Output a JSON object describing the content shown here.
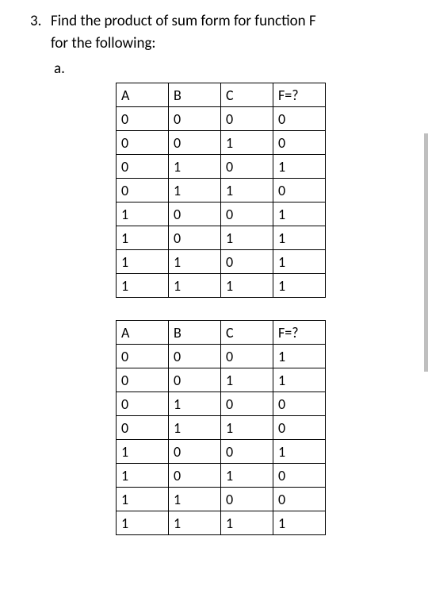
{
  "question": {
    "number": "3.",
    "line1": "Find the product of sum form for function F",
    "line2": "for the following:",
    "sub_label": "a."
  },
  "table_headers": {
    "A": "A",
    "B": "B",
    "C": "C",
    "F": "F=?"
  },
  "tables": [
    {
      "rows": [
        {
          "A": "0",
          "B": "0",
          "C": "0",
          "F": "0"
        },
        {
          "A": "0",
          "B": "0",
          "C": "1",
          "F": "0"
        },
        {
          "A": "0",
          "B": "1",
          "C": "0",
          "F": "1"
        },
        {
          "A": "0",
          "B": "1",
          "C": "1",
          "F": "0"
        },
        {
          "A": "1",
          "B": "0",
          "C": "0",
          "F": "1"
        },
        {
          "A": "1",
          "B": "0",
          "C": "1",
          "F": "1"
        },
        {
          "A": "1",
          "B": "1",
          "C": "0",
          "F": "1"
        },
        {
          "A": "1",
          "B": "1",
          "C": "1",
          "F": "1"
        }
      ]
    },
    {
      "rows": [
        {
          "A": "0",
          "B": "0",
          "C": "0",
          "F": "1"
        },
        {
          "A": "0",
          "B": "0",
          "C": "1",
          "F": "1"
        },
        {
          "A": "0",
          "B": "1",
          "C": "0",
          "F": "0"
        },
        {
          "A": "0",
          "B": "1",
          "C": "1",
          "F": "0"
        },
        {
          "A": "1",
          "B": "0",
          "C": "0",
          "F": "1"
        },
        {
          "A": "1",
          "B": "0",
          "C": "1",
          "F": "0"
        },
        {
          "A": "1",
          "B": "1",
          "C": "0",
          "F": "0"
        },
        {
          "A": "1",
          "B": "1",
          "C": "1",
          "F": "1"
        }
      ]
    }
  ],
  "chart_data": [
    {
      "type": "table",
      "columns": [
        "A",
        "B",
        "C",
        "F=?"
      ],
      "rows": [
        [
          0,
          0,
          0,
          0
        ],
        [
          0,
          0,
          1,
          0
        ],
        [
          0,
          1,
          0,
          1
        ],
        [
          0,
          1,
          1,
          0
        ],
        [
          1,
          0,
          0,
          1
        ],
        [
          1,
          0,
          1,
          1
        ],
        [
          1,
          1,
          0,
          1
        ],
        [
          1,
          1,
          1,
          1
        ]
      ]
    },
    {
      "type": "table",
      "columns": [
        "A",
        "B",
        "C",
        "F=?"
      ],
      "rows": [
        [
          0,
          0,
          0,
          1
        ],
        [
          0,
          0,
          1,
          1
        ],
        [
          0,
          1,
          0,
          0
        ],
        [
          0,
          1,
          1,
          0
        ],
        [
          1,
          0,
          0,
          1
        ],
        [
          1,
          0,
          1,
          0
        ],
        [
          1,
          1,
          0,
          0
        ],
        [
          1,
          1,
          1,
          1
        ]
      ]
    }
  ]
}
